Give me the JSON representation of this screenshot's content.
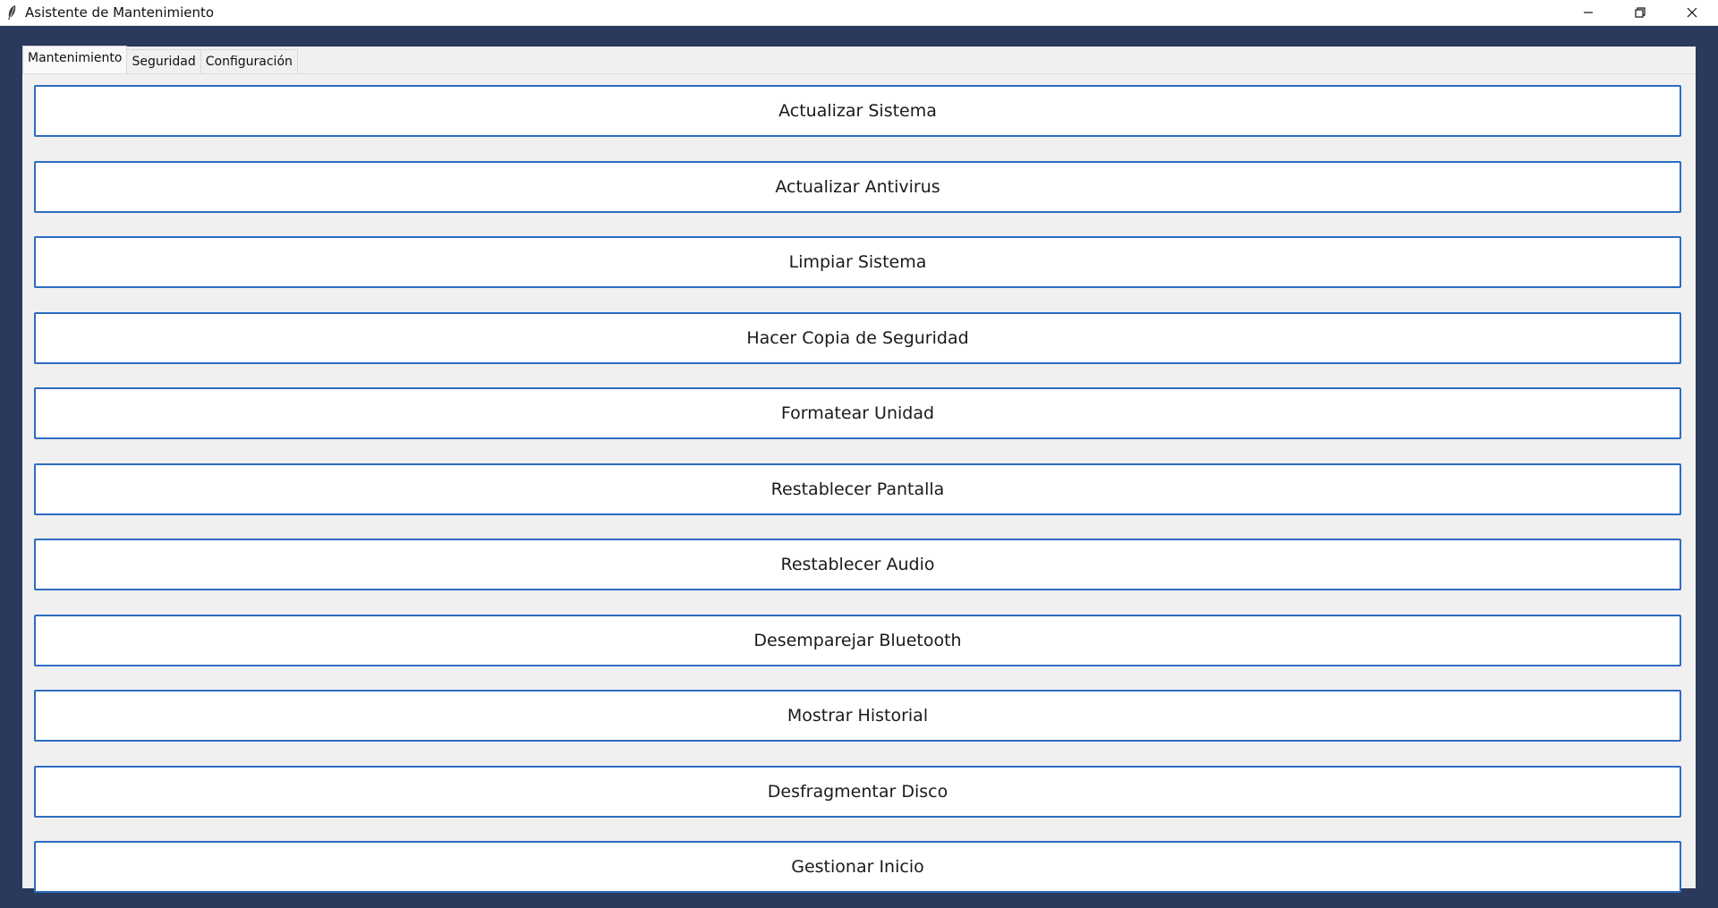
{
  "window": {
    "title": "Asistente de Mantenimiento",
    "icons": {
      "app": "feather-icon",
      "minimize": "minimize-icon",
      "restore": "restore-icon",
      "close": "close-icon"
    }
  },
  "tabs": [
    {
      "label": "Mantenimiento",
      "active": true
    },
    {
      "label": "Seguridad",
      "active": false
    },
    {
      "label": "Configuración",
      "active": false
    }
  ],
  "buttons": [
    {
      "label": "Actualizar Sistema"
    },
    {
      "label": "Actualizar Antivirus"
    },
    {
      "label": "Limpiar Sistema"
    },
    {
      "label": "Hacer Copia de Seguridad"
    },
    {
      "label": "Formatear Unidad"
    },
    {
      "label": "Restablecer Pantalla"
    },
    {
      "label": "Restablecer Audio"
    },
    {
      "label": "Desemparejar Bluetooth"
    },
    {
      "label": "Mostrar Historial"
    },
    {
      "label": "Desfragmentar Disco"
    },
    {
      "label": "Gestionar Inicio"
    }
  ],
  "colors": {
    "background": "#2b3a5c",
    "panel": "#f0f0f0",
    "button_border": "#2d6cc0"
  }
}
